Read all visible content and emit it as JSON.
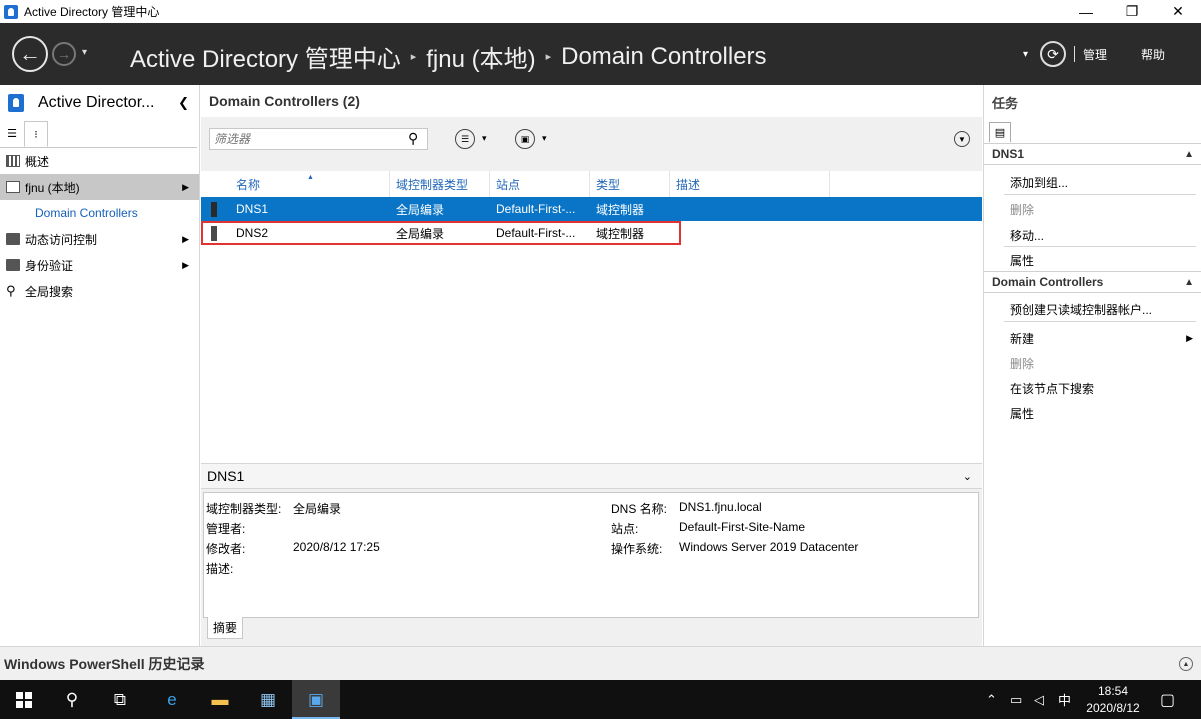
{
  "window": {
    "title": "Active Directory 管理中心",
    "minimize": "—",
    "restore": "❐",
    "close": "✕"
  },
  "nav": {
    "back_icon": "←",
    "forward_icon": "→",
    "dropdown_icon": "▾",
    "breadcrumb": [
      "Active Directory 管理中心",
      "fjnu (本地)",
      "Domain Controllers"
    ],
    "sep": "▸",
    "refresh_icon": "⟳",
    "manage": "管理",
    "help": "帮助"
  },
  "left": {
    "title": "Active Director...",
    "collapse": "❮",
    "items": [
      {
        "label": "概述"
      },
      {
        "label": "fjnu (本地)"
      },
      {
        "label": "Domain Controllers"
      },
      {
        "label": "动态访问控制"
      },
      {
        "label": "身份验证"
      },
      {
        "label": "全局搜索"
      }
    ],
    "arrow": "▶"
  },
  "center": {
    "header": "Domain Controllers  (2)",
    "filter_placeholder": "筛选器",
    "columns": [
      "名称",
      "域控制器类型",
      "站点",
      "类型",
      "描述"
    ],
    "rows": [
      {
        "name": "DNS1",
        "dc_type": "全局编录",
        "site": "Default-First-...",
        "type": "域控制器",
        "desc": ""
      },
      {
        "name": "DNS2",
        "dc_type": "全局编录",
        "site": "Default-First-...",
        "type": "域控制器",
        "desc": ""
      }
    ]
  },
  "details": {
    "title": "DNS1",
    "labels": {
      "dc_type": "域控制器类型:",
      "managed_by": "管理者:",
      "modified_by": "修改者:",
      "description": "描述:",
      "dns_name": "DNS 名称:",
      "site": "站点:",
      "os": "操作系统:"
    },
    "values": {
      "dc_type": "全局编录",
      "modified": "2020/8/12 17:25",
      "dns_name": "DNS1.fjnu.local",
      "site": "Default-First-Site-Name",
      "os": "Windows Server 2019 Datacenter"
    },
    "tab": "摘要"
  },
  "tasks": {
    "title": "任务",
    "section1": "DNS1",
    "section1_items": [
      "添加到组...",
      "删除",
      "移动...",
      "属性"
    ],
    "section2": "Domain Controllers",
    "section2_items": [
      "预创建只读域控制器帐户...",
      "新建",
      "删除",
      "在该节点下搜索",
      "属性"
    ]
  },
  "powershell": {
    "label": "Windows PowerShell 历史记录"
  },
  "taskbar": {
    "time": "18:54",
    "date": "2020/8/12",
    "ime": "中"
  },
  "colors": {
    "selection": "#0a74c6",
    "header_link": "#2368b8",
    "nav_bg": "#2b2b2b",
    "highlight_outline": "#e23333"
  }
}
